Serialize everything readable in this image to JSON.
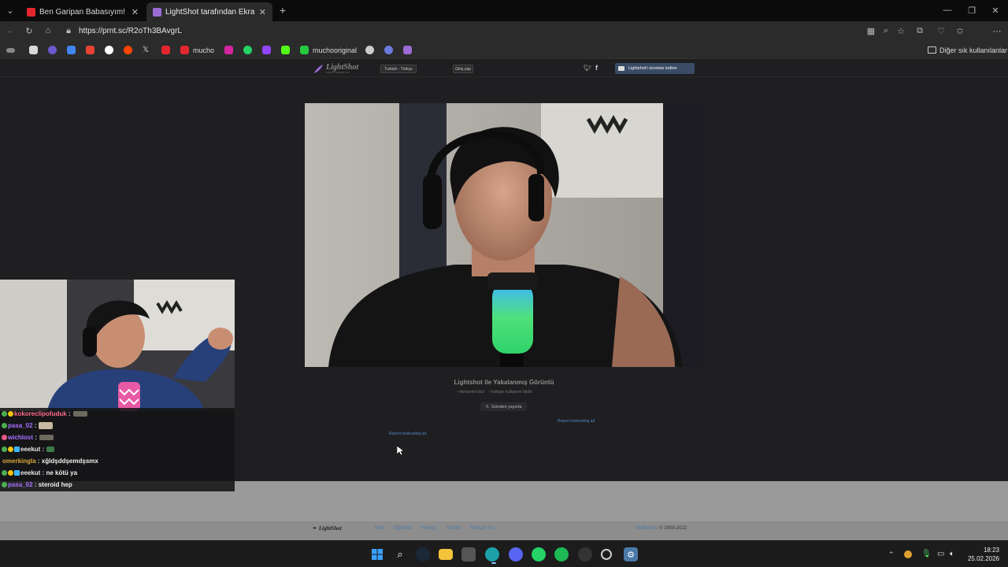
{
  "browser": {
    "tabs": [
      {
        "title": "Ben Garipan Babasıyım! Avdo Day",
        "favicon_color": "#e3262e",
        "active": false
      },
      {
        "title": "LightShot tarafından Ekran Görünt",
        "favicon_color": "#9b6bd6",
        "active": true
      }
    ],
    "url": "https://prnt.sc/R2oTh3BAvgrL",
    "bookmarks": [
      {
        "label": "mucho",
        "color": "#e3262e"
      },
      {
        "label": "muchooriginal",
        "color": "#28c840"
      }
    ],
    "bookmarks_folder": "Diğer sık kullanılanlar",
    "profile_color": "#c0392b"
  },
  "lightshot": {
    "logo": "LightShot",
    "logo_tagline": "screen capture tool",
    "language_select": "Turkish - Türkçe",
    "login_button": "Giriş yap",
    "download_button": "Lightshot'ı ücretsiz indirin",
    "caption_title": "Lightshot ile Yakalanmış Görüntü",
    "caption_link_similar": "benzerini bul",
    "caption_link_report": "kötüye kullanım bildir",
    "share_button": "Gönderi yayınla",
    "report_ad_right": "Report misleading ad",
    "report_ad_left": "Report misleading ad"
  },
  "footer": {
    "logo": "LightShot",
    "links": [
      "İndir",
      "Öğretiler",
      "Privacy",
      "Yardım",
      "Reklam Ver"
    ],
    "company": "Skillbrains",
    "copyright": "© 2009-2022"
  },
  "chat": [
    {
      "user": "kokoreclipofuduk",
      "color": "#ff6b8a",
      "message": ""
    },
    {
      "user": "pasa_02",
      "color": "#a970ff",
      "message": ""
    },
    {
      "user": "wichlost",
      "color": "#a970ff",
      "message": ""
    },
    {
      "user": "eeekut",
      "color": "#e8e8e8",
      "message": ""
    },
    {
      "user": "omerkingla",
      "color": "#d8a83a",
      "message": "xğldşddşemdşsmx"
    },
    {
      "user": "eeekut",
      "color": "#e8e8e8",
      "message": "ne kötü ya"
    },
    {
      "user": "pasa_02",
      "color": "#a970ff",
      "message": "steroid hep"
    }
  ],
  "system": {
    "time": "18:23",
    "date": "25.02.2026"
  }
}
